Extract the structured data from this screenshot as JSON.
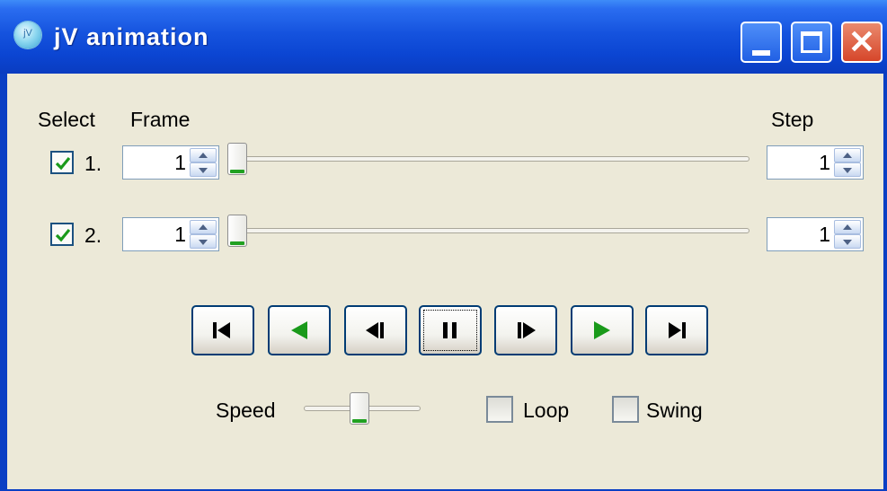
{
  "window": {
    "title": "jV animation",
    "icon": "jv-app-icon"
  },
  "titlebar_buttons": [
    "minimize-button",
    "maximize-button",
    "close-button"
  ],
  "headers": {
    "select": "Select",
    "frame": "Frame",
    "step": "Step"
  },
  "rows": [
    {
      "label": "1.",
      "checked": true,
      "frame": "1",
      "step": "1",
      "slider_fraction": 0
    },
    {
      "label": "2.",
      "checked": true,
      "frame": "1",
      "step": "1",
      "slider_fraction": 0
    }
  ],
  "playback_buttons": [
    "first-frame",
    "play-backward",
    "step-backward",
    "pause",
    "step-forward",
    "play-forward",
    "last-frame"
  ],
  "speed": {
    "label": "Speed",
    "slider_fraction": 0.5
  },
  "loop": {
    "label": "Loop",
    "checked": false
  },
  "swing": {
    "label": "Swing",
    "checked": false
  },
  "colors": {
    "accent_green": "#1a9a1a",
    "titlebar_blue": "#0b45d2",
    "face": "#ece9d8"
  }
}
